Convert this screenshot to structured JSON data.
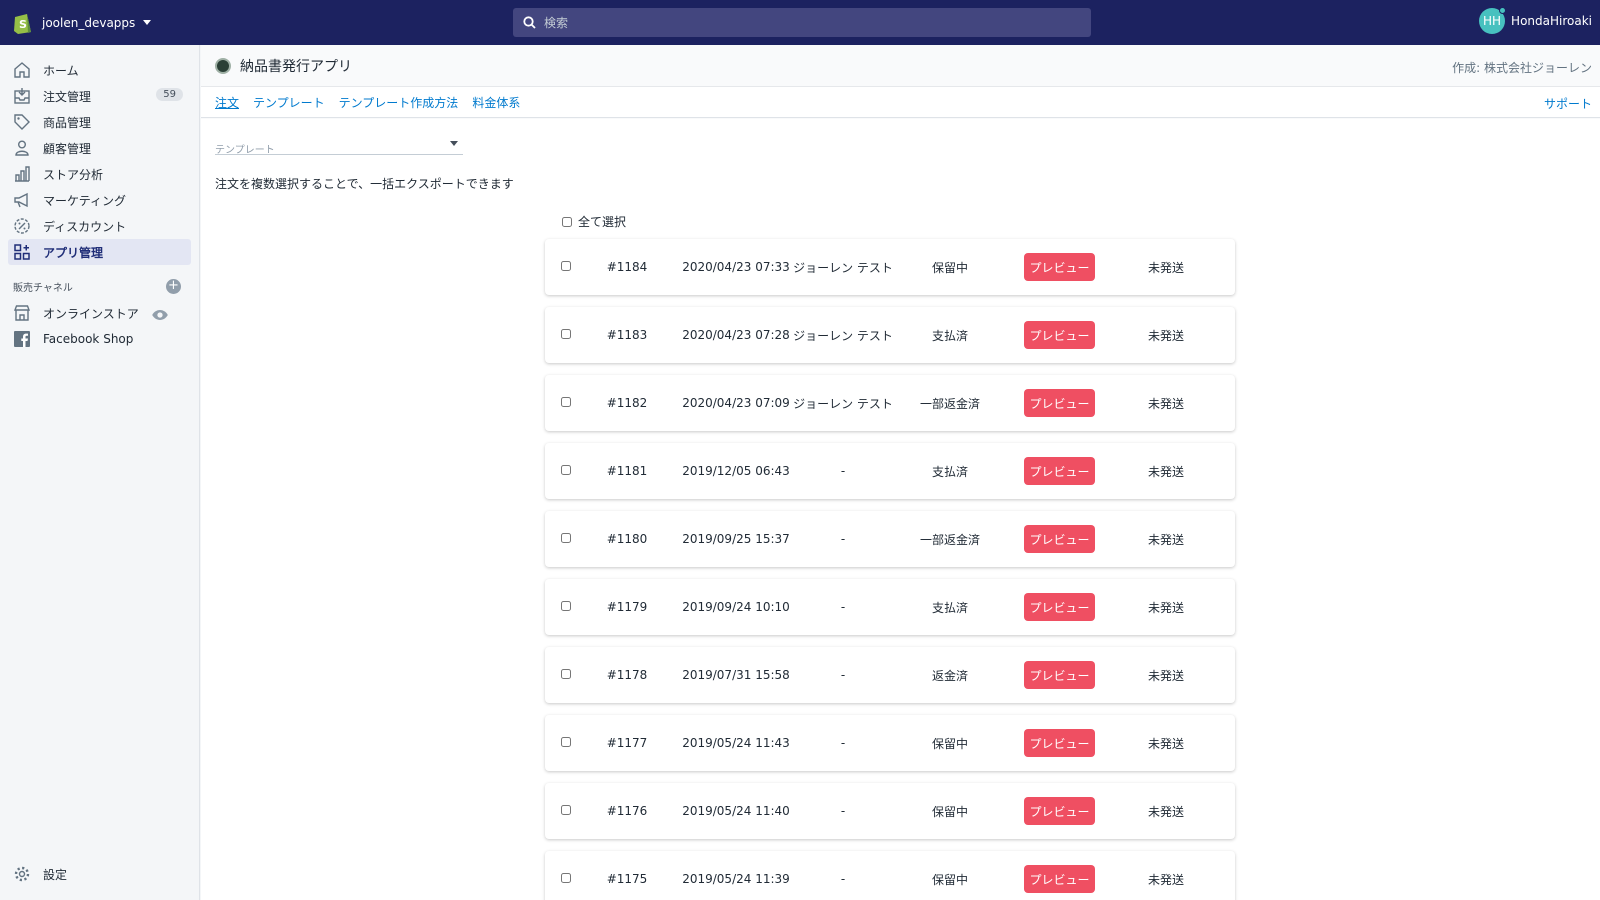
{
  "topbar": {
    "store_name": "joolen_devapps",
    "search_placeholder": "検索",
    "user_initials": "HH",
    "user_name": "HondaHiroaki"
  },
  "sidebar": {
    "items": [
      {
        "label": "ホーム",
        "icon": "home-icon"
      },
      {
        "label": "注文管理",
        "icon": "orders-icon",
        "badge": "59"
      },
      {
        "label": "商品管理",
        "icon": "tag-icon"
      },
      {
        "label": "顧客管理",
        "icon": "person-icon"
      },
      {
        "label": "ストア分析",
        "icon": "analytics-icon"
      },
      {
        "label": "マーケティング",
        "icon": "megaphone-icon"
      },
      {
        "label": "ディスカウント",
        "icon": "discount-icon"
      },
      {
        "label": "アプリ管理",
        "icon": "apps-icon"
      }
    ],
    "channels_heading": "販売チャネル",
    "channels": [
      {
        "label": "オンラインストア",
        "icon": "store-icon"
      },
      {
        "label": "Facebook Shop",
        "icon": "facebook-icon"
      }
    ],
    "settings_label": "設定"
  },
  "app": {
    "title": "納品書発行アプリ",
    "author": "作成: 株式会社ジョーレン",
    "tabs": [
      "注文",
      "テンプレート",
      "テンプレート作成方法",
      "料金体系"
    ],
    "support": "サポート",
    "template_placeholder": "テンプレート",
    "hint": "注文を複数選択することで、一括エクスポートできます",
    "select_all": "全て選択",
    "preview_label": "プレビュー"
  },
  "orders": [
    {
      "no": "#1184",
      "date": "2020/04/23 07:33",
      "customer": "ジョーレン テスト",
      "payment": "保留中",
      "shipping": "未発送"
    },
    {
      "no": "#1183",
      "date": "2020/04/23 07:28",
      "customer": "ジョーレン テスト",
      "payment": "支払済",
      "shipping": "未発送"
    },
    {
      "no": "#1182",
      "date": "2020/04/23 07:09",
      "customer": "ジョーレン テスト",
      "payment": "一部返金済",
      "shipping": "未発送"
    },
    {
      "no": "#1181",
      "date": "2019/12/05 06:43",
      "customer": "-",
      "payment": "支払済",
      "shipping": "未発送"
    },
    {
      "no": "#1180",
      "date": "2019/09/25 15:37",
      "customer": "-",
      "payment": "一部返金済",
      "shipping": "未発送"
    },
    {
      "no": "#1179",
      "date": "2019/09/24 10:10",
      "customer": "-",
      "payment": "支払済",
      "shipping": "未発送"
    },
    {
      "no": "#1178",
      "date": "2019/07/31 15:58",
      "customer": "-",
      "payment": "返金済",
      "shipping": "未発送"
    },
    {
      "no": "#1177",
      "date": "2019/05/24 11:43",
      "customer": "-",
      "payment": "保留中",
      "shipping": "未発送"
    },
    {
      "no": "#1176",
      "date": "2019/05/24 11:40",
      "customer": "-",
      "payment": "保留中",
      "shipping": "未発送"
    },
    {
      "no": "#1175",
      "date": "2019/05/24 11:39",
      "customer": "-",
      "payment": "保留中",
      "shipping": "未発送"
    }
  ],
  "colors": {
    "topbar": "#1c2260",
    "accent_button": "#ef4f62",
    "link": "#007ace",
    "active_nav": "#202e78"
  }
}
